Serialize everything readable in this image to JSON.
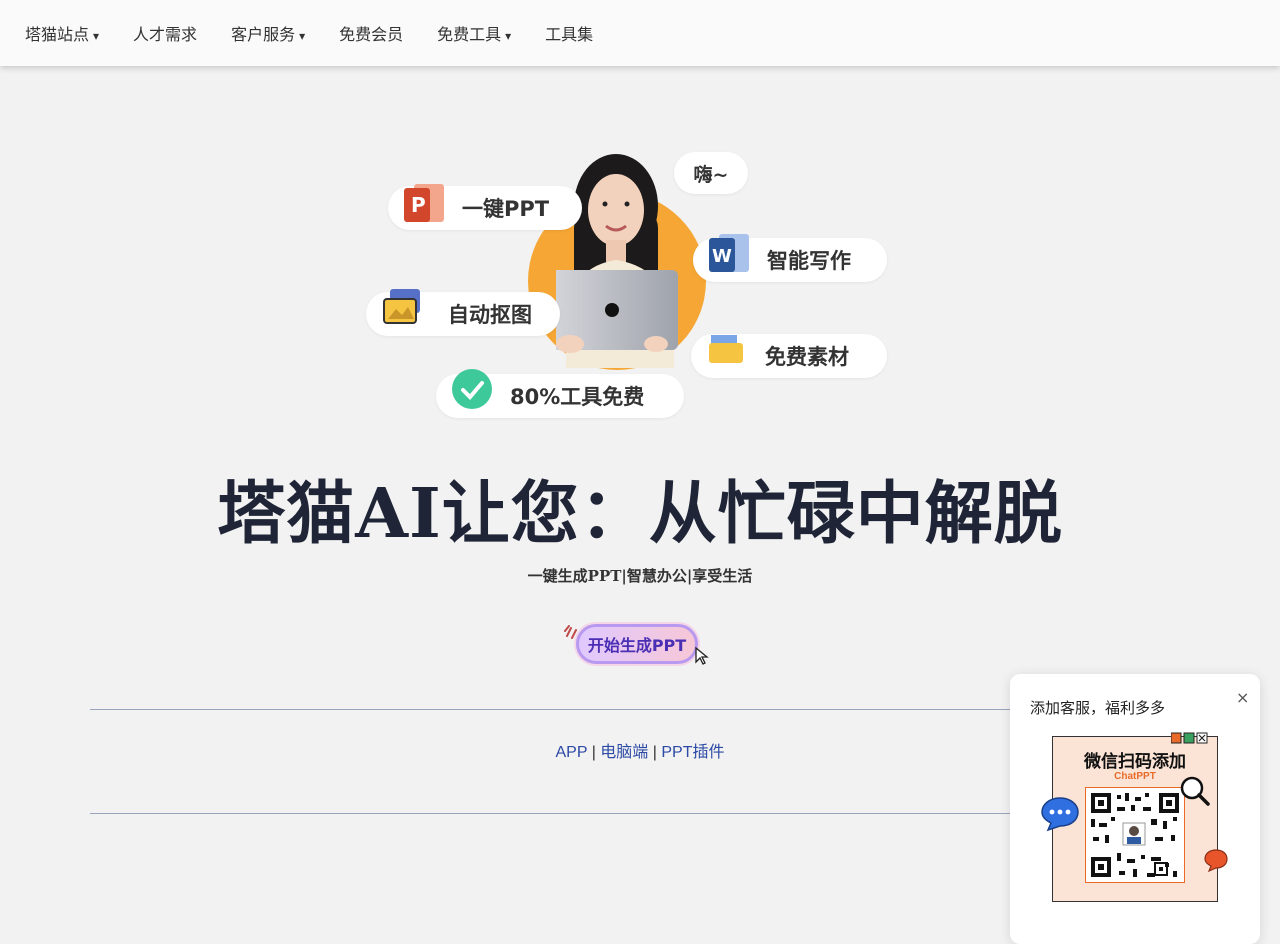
{
  "nav": {
    "items": [
      {
        "label": "塔猫站点",
        "caret": "▾"
      },
      {
        "label": "人才需求",
        "caret": ""
      },
      {
        "label": "客户服务",
        "caret": "▾"
      },
      {
        "label": "免费会员",
        "caret": ""
      },
      {
        "label": "免费工具",
        "caret": "▾"
      },
      {
        "label": "工具集",
        "caret": ""
      }
    ]
  },
  "hero": {
    "greeting": "嗨~",
    "features": {
      "ppt": "一键PPT",
      "writing": "智能写作",
      "cutout": "自动抠图",
      "materials": "免费素材",
      "free_tools": "80%工具免费"
    }
  },
  "headline": "塔猫AI让您：从忙碌中解脱",
  "subline": "一键生成PPT|智慧办公|享受生活",
  "cta": {
    "label": "开始生成PPT"
  },
  "links": {
    "app": "APP",
    "sep": "|",
    "desktop": "电脑端",
    "plugin": "PPT插件"
  },
  "popup": {
    "title": "添加客服，福利多多",
    "close": "×",
    "qr_heading": "微信扫码添加",
    "qr_brand": "ChatPPT"
  },
  "colors": {
    "accent_orange": "#f5a634",
    "headline": "#1f2536",
    "link": "#2d4aa6",
    "cta_text": "#4a2fb5"
  }
}
